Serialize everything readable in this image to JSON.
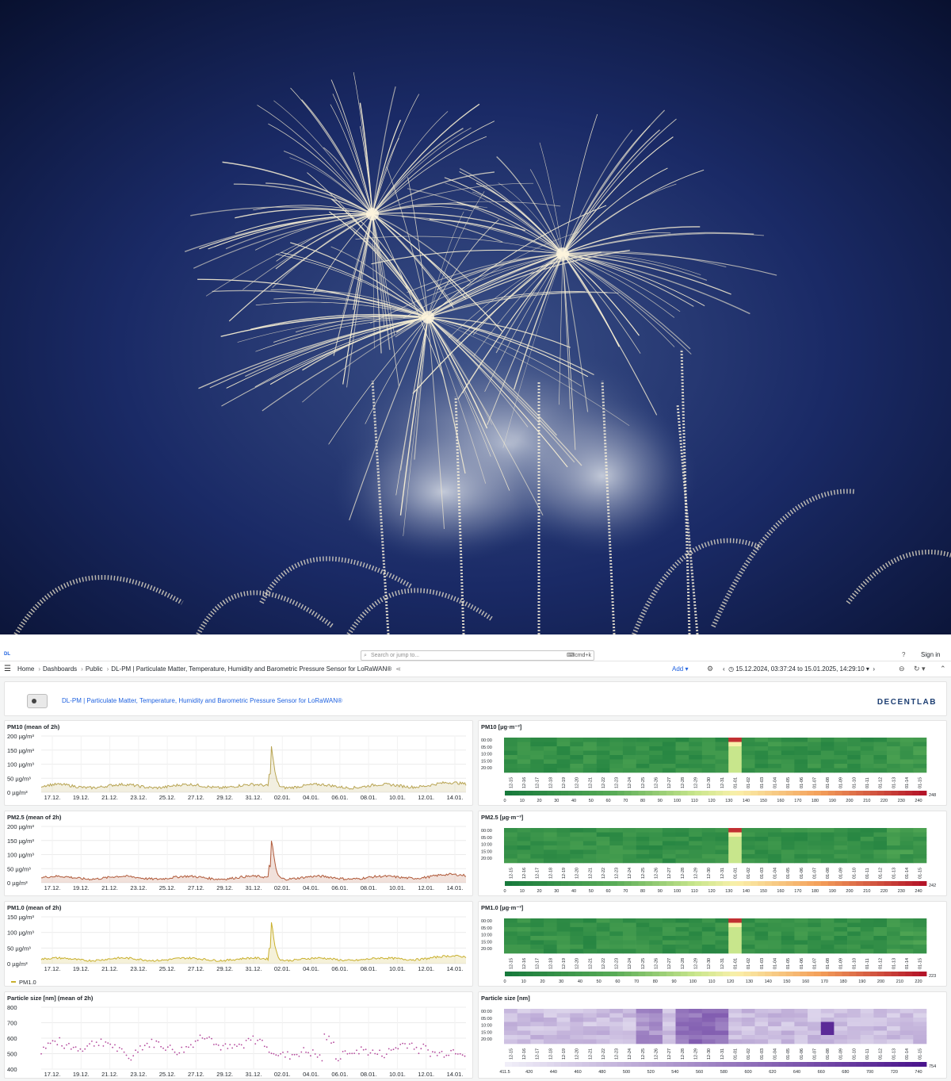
{
  "app": {
    "logo": "DL",
    "search_placeholder": "Search or jump to...",
    "search_shortcut": "cmd+k",
    "sign_in": "Sign in"
  },
  "breadcrumb": {
    "home": "Home",
    "dashboards": "Dashboards",
    "public": "Public",
    "current": "DL-PM | Particulate Matter, Temperature, Humidity and Barometric Pressure Sensor for LoRaWAN®"
  },
  "toolbar": {
    "add_label": "Add",
    "time_range": "15.12.2024, 03:37:24 to 15.01.2025, 14:29:10"
  },
  "header": {
    "title": "DL-PM | Particulate Matter, Temperature, Humidity and Barometric Pressure Sensor for LoRaWAN®",
    "brand": "DECENTLAB"
  },
  "timeseries_x_labels": [
    "17.12.",
    "19.12.",
    "21.12.",
    "23.12.",
    "25.12.",
    "27.12.",
    "29.12.",
    "31.12.",
    "02.01.",
    "04.01.",
    "06.01.",
    "08.01.",
    "10.01.",
    "12.01.",
    "14.01."
  ],
  "heatmap_rows": [
    "00:00",
    "05:00",
    "10:00",
    "15:00",
    "20:00"
  ],
  "heatmap_days": [
    "12-15",
    "12-16",
    "12-17",
    "12-18",
    "12-19",
    "12-20",
    "12-21",
    "12-22",
    "12-23",
    "12-24",
    "12-25",
    "12-26",
    "12-27",
    "12-28",
    "12-29",
    "12-30",
    "12-31",
    "01-01",
    "01-02",
    "01-03",
    "01-04",
    "01-05",
    "01-06",
    "01-07",
    "01-08",
    "01-09",
    "01-10",
    "01-11",
    "01-12",
    "01-13",
    "01-14",
    "01-15"
  ],
  "panels": {
    "pm10_ts": {
      "title": "PM10 (mean of 2h)",
      "y_ticks": [
        "200 µg/m³",
        "150 µg/m³",
        "100 µg/m³",
        "50 µg/m³",
        "0 µg/m³"
      ],
      "color": "#b8a452"
    },
    "pm25_ts": {
      "title": "PM2.5 (mean of 2h)",
      "y_ticks": [
        "200 µg/m³",
        "150 µg/m³",
        "100 µg/m³",
        "50 µg/m³",
        "0 µg/m³"
      ],
      "color": "#b05a3a"
    },
    "pm1_ts": {
      "title": "PM1.0 (mean of 2h)",
      "y_ticks": [
        "150 µg/m³",
        "100 µg/m³",
        "50 µg/m³",
        "0 µg/m³"
      ],
      "color": "#c9b02e",
      "legend": "PM1.0"
    },
    "size_ts": {
      "title": "Particle size [nm] (mean of 2h)",
      "y_ticks": [
        "800",
        "700",
        "600",
        "500",
        "400"
      ],
      "color": "#b3479b"
    },
    "pm10_hm": {
      "title": "PM10 [µg·m⁻³]",
      "scale": [
        "0",
        "10",
        "20",
        "30",
        "40",
        "50",
        "60",
        "70",
        "80",
        "90",
        "100",
        "110",
        "120",
        "130",
        "140",
        "150",
        "160",
        "170",
        "180",
        "190",
        "200",
        "210",
        "220",
        "230",
        "240"
      ],
      "max_label": "248"
    },
    "pm25_hm": {
      "title": "PM2.5 [µg·m⁻³]",
      "scale": [
        "0",
        "10",
        "20",
        "30",
        "40",
        "50",
        "60",
        "70",
        "80",
        "90",
        "100",
        "110",
        "120",
        "130",
        "140",
        "150",
        "160",
        "170",
        "180",
        "190",
        "200",
        "210",
        "220",
        "230",
        "240"
      ],
      "max_label": "242"
    },
    "pm1_hm": {
      "title": "PM1.0 [µg·m⁻³]",
      "scale": [
        "0",
        "10",
        "20",
        "30",
        "40",
        "50",
        "60",
        "70",
        "80",
        "90",
        "100",
        "110",
        "120",
        "130",
        "140",
        "150",
        "160",
        "170",
        "180",
        "190",
        "200",
        "210",
        "220"
      ],
      "max_label": "223"
    },
    "size_hm": {
      "title": "Particle size [nm]",
      "scale": [
        "411.5",
        "420",
        "440",
        "460",
        "480",
        "500",
        "520",
        "540",
        "560",
        "580",
        "600",
        "620",
        "640",
        "660",
        "680",
        "700",
        "720",
        "740"
      ],
      "max_label": "754"
    }
  }
}
